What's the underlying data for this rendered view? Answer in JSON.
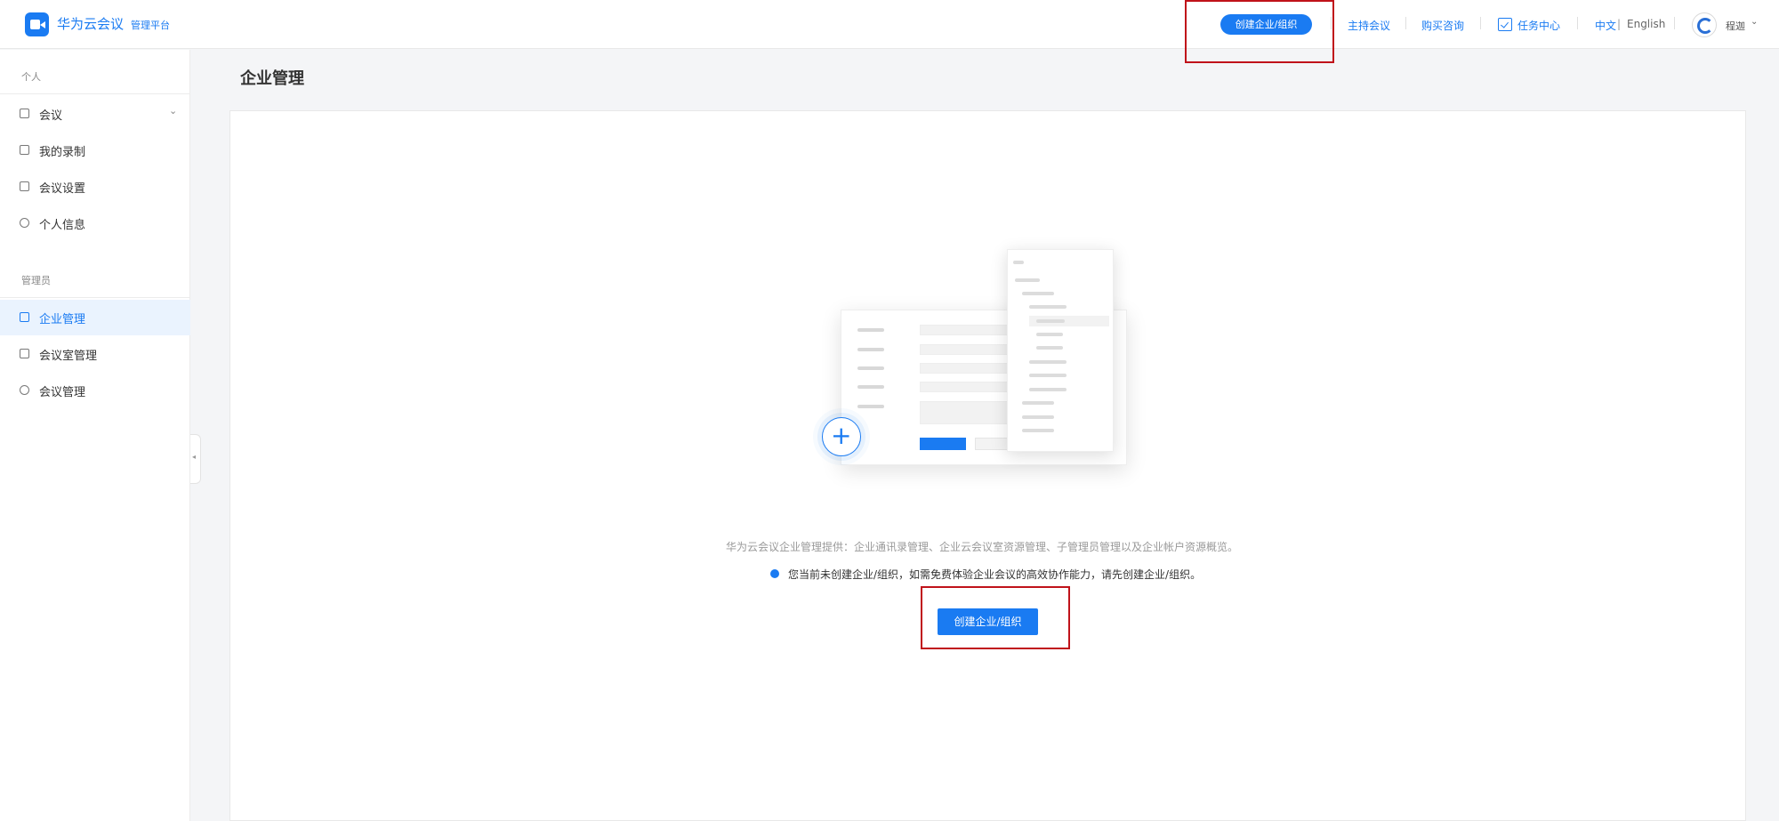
{
  "header": {
    "app_name": "华为云会议",
    "app_sub": "管理平台",
    "create_org": "创建企业/组织",
    "host_meeting": "主持会议",
    "purchase": "购买咨询",
    "task_center": "任务中心",
    "lang_zh": "中文",
    "lang_sep": "|",
    "lang_en": "English",
    "user_name": "程迦",
    "user_caret": "⌄"
  },
  "sidebar": {
    "section_personal": "个人",
    "personal_items": [
      {
        "label": "会议",
        "icon": "meeting-icon",
        "has_chevron": true
      },
      {
        "label": "我的录制",
        "icon": "recording-icon"
      },
      {
        "label": "会议设置",
        "icon": "calendar-settings-icon"
      },
      {
        "label": "个人信息",
        "icon": "user-icon"
      }
    ],
    "chevron": "⌄",
    "section_admin": "管理员",
    "admin_items": [
      {
        "label": "企业管理",
        "icon": "enterprise-icon",
        "active": true
      },
      {
        "label": "会议室管理",
        "icon": "meeting-room-icon"
      },
      {
        "label": "会议管理",
        "icon": "globe-icon"
      }
    ],
    "collapse": "◂"
  },
  "main": {
    "title": "企业管理",
    "description": "华为云会议企业管理提供：企业通讯录管理、企业云会议室资源管理、子管理员管理以及企业帐户资源概览。",
    "notice": "您当前未创建企业/组织，如需免费体验企业会议的高效协作能力，请先创建企业/组织。",
    "create_button": "创建企业/组织",
    "plus": "+"
  },
  "colors": {
    "accent": "#1a7bf2",
    "highlight": "#c0121a"
  }
}
